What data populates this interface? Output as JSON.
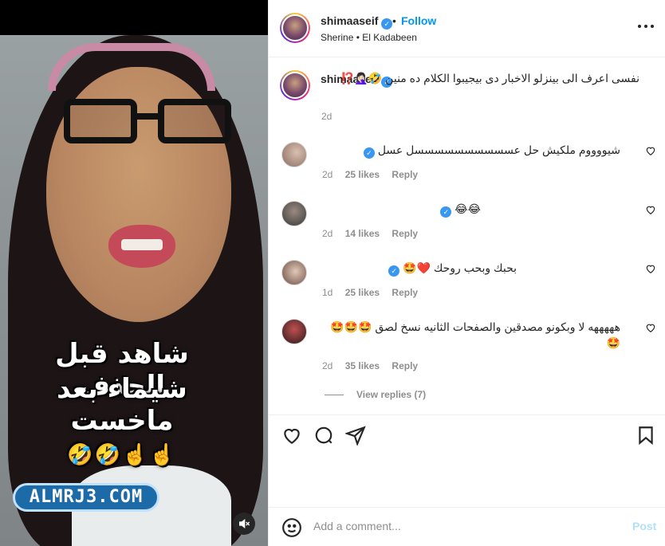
{
  "media": {
    "overlay_line1": "شاهد قبل الحذف",
    "overlay_line2": "شيماء بعد ماخست",
    "overlay_emojis": "☝️☝️🤣🤣",
    "watermark": "ALMRJ3.COM",
    "mute_icon": "speaker-muted-icon"
  },
  "header": {
    "username": "shimaaseif",
    "follow_label": "Follow",
    "separator": "•",
    "subtitle": "Sherine • El Kadabeen",
    "more_icon": "more-options-icon"
  },
  "caption": {
    "username": "shimaaseif",
    "text": "نفسى اعرف الى بينزلو الاخبار دى بيجيبوا الكلام ده منين 🤣🤦🏻‍♀️⁉️",
    "time": "2d"
  },
  "comments": [
    {
      "text": "شيووووم ملكيش حل عسسسسسسسسسسل عسل",
      "time": "2d",
      "likes": "25 likes",
      "reply": "Reply"
    },
    {
      "text": "😂😂",
      "time": "2d",
      "likes": "14 likes",
      "reply": "Reply"
    },
    {
      "text": "بحبك وبحب روحك ❤️🤩",
      "time": "1d",
      "likes": "25 likes",
      "reply": "Reply"
    },
    {
      "text": "هههههه لا وبكونو مصدقين والصفحات الثانيه نسخ لصق 🤩🤩🤩🤩",
      "time": "2d",
      "likes": "35 likes",
      "reply": "Reply"
    }
  ],
  "view_replies": "View replies (7)",
  "composer": {
    "placeholder": "Add a comment...",
    "post_label": "Post"
  },
  "colors": {
    "accent": "#0095f6",
    "muted_text": "#8e8e8e",
    "post_disabled": "#b2dffc"
  }
}
